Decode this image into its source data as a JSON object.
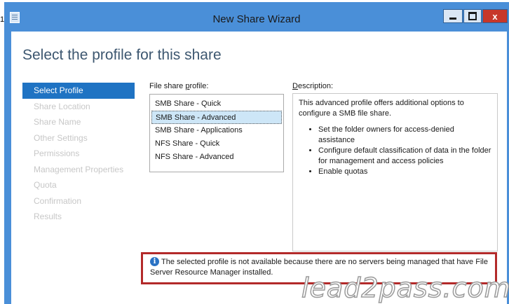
{
  "stub_text": "1:",
  "window": {
    "title": "New Share Wizard",
    "icon": "wizard-app-icon",
    "controls": {
      "minimize_icon": "minimize-icon",
      "maximize_icon": "maximize-icon",
      "close_label": "x"
    }
  },
  "heading": "Select the profile for this share",
  "nav": {
    "items": [
      {
        "label": "Select Profile",
        "active": true
      },
      {
        "label": "Share Location",
        "active": false
      },
      {
        "label": "Share Name",
        "active": false
      },
      {
        "label": "Other Settings",
        "active": false
      },
      {
        "label": "Permissions",
        "active": false
      },
      {
        "label": "Management Properties",
        "active": false
      },
      {
        "label": "Quota",
        "active": false
      },
      {
        "label": "Confirmation",
        "active": false
      },
      {
        "label": "Results",
        "active": false
      }
    ]
  },
  "profile": {
    "label_pre": "File share ",
    "label_access": "p",
    "label_post": "rofile:",
    "options": [
      "SMB Share - Quick",
      "SMB Share - Advanced",
      "SMB Share - Applications",
      "NFS Share - Quick",
      "NFS Share - Advanced"
    ],
    "selected": "SMB Share - Advanced"
  },
  "description": {
    "label_access": "D",
    "label_post": "escription:",
    "text": "This advanced profile offers additional options to configure a SMB file share.",
    "bullets": [
      "Set the folder owners for access-denied assistance",
      "Configure default classification of data in the folder for management and access policies",
      "Enable quotas"
    ]
  },
  "notice": {
    "icon": "info-icon",
    "text": "The selected profile is not available because there are no servers being managed that have File Server Resource Manager installed."
  },
  "watermark": "lead2pass.com",
  "colors": {
    "titlebar": "#4a8fd8",
    "nav_active": "#1f73c3",
    "notice_border": "#b32a2a",
    "heading": "#3d5770"
  }
}
